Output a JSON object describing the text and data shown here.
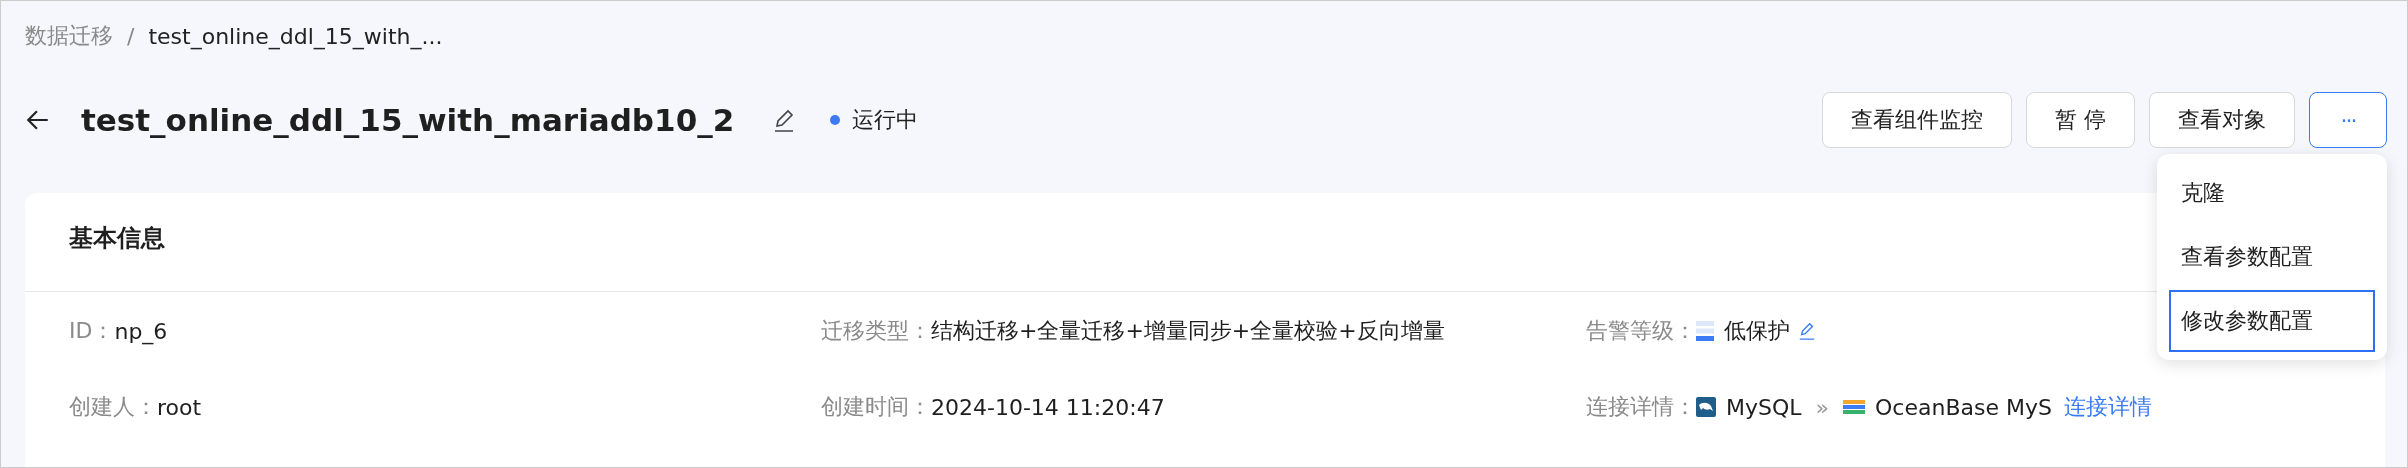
{
  "breadcrumb": [
    "数据迁移",
    "test_online_ddl_15_with_..."
  ],
  "breadcrumb_separator": "/",
  "title": "test_online_ddl_15_with_mariadb10_2",
  "status": {
    "label": "运行中",
    "color": "#3b7cf6"
  },
  "actions": [
    {
      "label": "查看组件监控"
    },
    {
      "label": "暂 停"
    },
    {
      "label": "查看对象"
    }
  ],
  "more_button": {
    "label": "···",
    "expanded": true
  },
  "menu": [
    {
      "label": "克隆",
      "selected": false
    },
    {
      "label": "查看参数配置",
      "selected": false
    },
    {
      "label": "修改参数配置",
      "selected": true
    }
  ],
  "card": {
    "title": "基本信息",
    "fields": [
      {
        "label": "ID：",
        "value": "np_6",
        "kind": "text"
      },
      {
        "label": "迁移类型：",
        "value": "结构迁移+全量迁移+增量同步+全量校验+反向增量",
        "kind": "text"
      },
      {
        "label": "告警等级：",
        "value": "低保护",
        "kind": "alert"
      },
      {
        "label": "创建人：",
        "value": "root",
        "kind": "text"
      },
      {
        "label": "创建时间：",
        "value": "2024-10-14 11:20:47",
        "kind": "text"
      },
      {
        "label": "连接详情：",
        "source": "MySQL",
        "separator": "»",
        "target": "OceanBase MyS",
        "link": "连接详情",
        "kind": "connection"
      }
    ]
  }
}
